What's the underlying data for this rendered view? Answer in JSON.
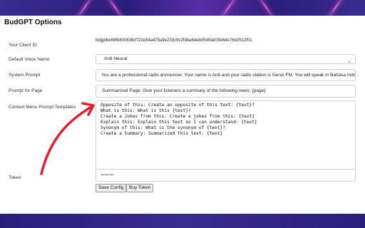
{
  "page": {
    "title": "BudGPT Options"
  },
  "form": {
    "client_id": {
      "label": "Your Client ID",
      "value": "bdgptbe68fb800638d722e54a479a9e233c9c2fdba64eb054fda03fe64e76d2512f01"
    },
    "voice": {
      "label": "Default Voice Name",
      "value": "Ardi Neural"
    },
    "system_prompt": {
      "label": "System Prompt",
      "value": "You are a professional radio announcer. Your name is Ardi and your radio station is Genzi FM. You will speak in Bahasa Indones"
    },
    "page_prompt": {
      "label": "Prompt for Page",
      "value": "Summarized Page: Give your listeners a summary of the following news: {page}"
    },
    "context_menu": {
      "label": "Context Menu Prompt Templates",
      "lines": [
        "Opposite of this: Create an opposite of this text: {text}?",
        "What is this: What is this {text}?",
        "Create a Jokes from this: Create a jokes from this: {text}",
        "Explain this: Explain this text so I can understand: {text}",
        "Synonym of this: What is the synonym of {text}?",
        "Create a Summary: Summarized this text: {text}"
      ]
    },
    "token": {
      "label": "Token",
      "value": "••••••••"
    }
  },
  "buttons": {
    "save": "Save Config",
    "buy": "Buy Token"
  },
  "icons": {
    "select_caret": "chevron-down-icon",
    "annotation": "red-curved-arrow-icon"
  },
  "colors": {
    "background": "#2a1f6e",
    "panel": "#ffffff",
    "annotation_arrow": "#e0202a"
  }
}
